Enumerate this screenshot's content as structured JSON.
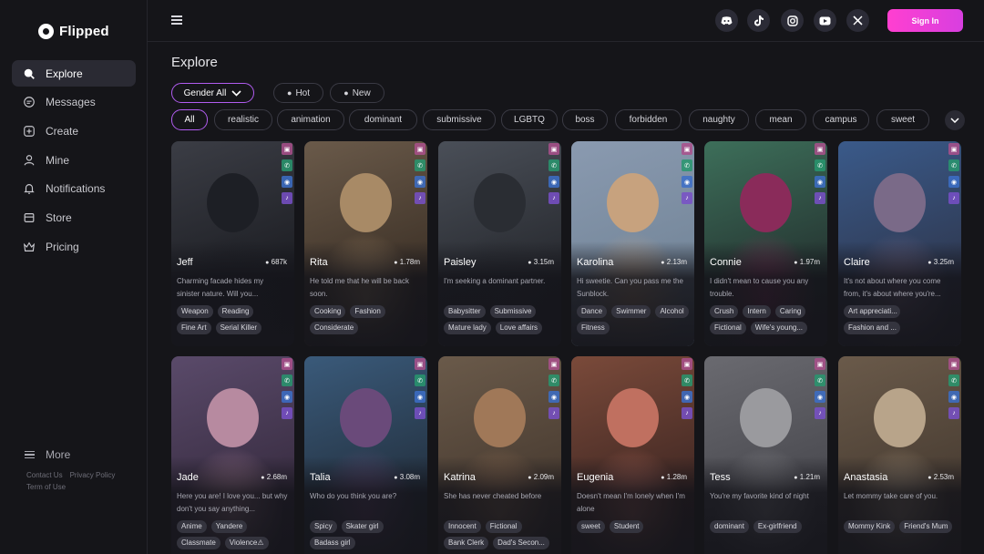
{
  "app": {
    "name": "Flipped"
  },
  "sidebar": {
    "items": [
      {
        "label": "Explore",
        "icon": "search-icon",
        "active": true
      },
      {
        "label": "Messages",
        "icon": "chat-icon"
      },
      {
        "label": "Create",
        "icon": "plus-square-icon"
      },
      {
        "label": "Mine",
        "icon": "user-icon"
      },
      {
        "label": "Notifications",
        "icon": "bell-icon"
      },
      {
        "label": "Store",
        "icon": "store-icon"
      },
      {
        "label": "Pricing",
        "icon": "crown-icon"
      }
    ],
    "more_label": "More",
    "footer": {
      "contact": "Contact Us",
      "privacy": "Privacy Policy",
      "terms": "Term of Use"
    }
  },
  "header": {
    "signin_label": "Sign In",
    "socials": [
      "discord-icon",
      "tiktok-icon",
      "instagram-icon",
      "youtube-icon",
      "x-icon"
    ]
  },
  "main": {
    "title": "Explore",
    "filters": {
      "gender": "Gender All",
      "hot": "Hot",
      "new": "New"
    },
    "categories": [
      "All",
      "realistic",
      "animation",
      "dominant",
      "submissive",
      "LGBTQ",
      "boss",
      "forbidden",
      "naughty",
      "mean",
      "campus",
      "sweet"
    ],
    "cards": [
      {
        "name": "Jeff",
        "count": "687k",
        "desc": "Charming facade hides my sinister nature. Will you...",
        "tags": [
          "Weapon",
          "Reading",
          "Fine Art",
          "Serial Killer"
        ]
      },
      {
        "name": "Rita",
        "count": "1.78m",
        "desc": "He told me that he will be back soon.",
        "tags": [
          "Cooking",
          "Fashion",
          "Considerate"
        ]
      },
      {
        "name": "Paisley",
        "count": "3.15m",
        "desc": "I'm seeking a dominant partner.",
        "tags": [
          "Babysitter",
          "Submissive",
          "Mature lady",
          "Love affairs"
        ]
      },
      {
        "name": "Karolina",
        "count": "2.13m",
        "desc": "Hi sweetie. Can you pass me the Sunblock.",
        "tags": [
          "Dance",
          "Swimmer",
          "Alcohol",
          "Fitness"
        ]
      },
      {
        "name": "Connie",
        "count": "1.97m",
        "desc": "I didn't mean to cause you any trouble.",
        "tags": [
          "Crush",
          "Intern",
          "Caring",
          "Fictional",
          "Wife's young..."
        ]
      },
      {
        "name": "Claire",
        "count": "3.25m",
        "desc": "It's not about where you come from, it's about where you're...",
        "tags": [
          "Art appreciati...",
          "Fashion and ..."
        ]
      },
      {
        "name": "Jade",
        "count": "2.68m",
        "desc": "Here you are! I love you... but why don't you say anything...",
        "tags": [
          "Anime",
          "Yandere",
          "Classmate",
          "Violence⚠"
        ]
      },
      {
        "name": "Talia",
        "count": "3.08m",
        "desc": "Who do you think you are?",
        "tags": [
          "Spicy",
          "Skater girl",
          "Badass girl"
        ]
      },
      {
        "name": "Katrina",
        "count": "2.09m",
        "desc": "She has never cheated before",
        "tags": [
          "Innocent",
          "Fictional",
          "Bank Clerk",
          "Dad's Secon..."
        ]
      },
      {
        "name": "Eugenia",
        "count": "1.28m",
        "desc": "Doesn't mean I'm lonely when I'm alone",
        "tags": [
          "sweet",
          "Student"
        ]
      },
      {
        "name": "Tess",
        "count": "1.21m",
        "desc": "You're my favorite kind of night",
        "tags": [
          "dominant",
          "Ex-girlfriend"
        ]
      },
      {
        "name": "Anastasia",
        "count": "2.53m",
        "desc": "Let mommy take care of you.",
        "tags": [
          "Mommy Kink",
          "Friend's Mum"
        ]
      }
    ]
  },
  "colors": {
    "accent": "#b15cf0",
    "signin_gradient": [
      "#ff3fd0",
      "#d83fe0"
    ],
    "bg": "#151519"
  }
}
